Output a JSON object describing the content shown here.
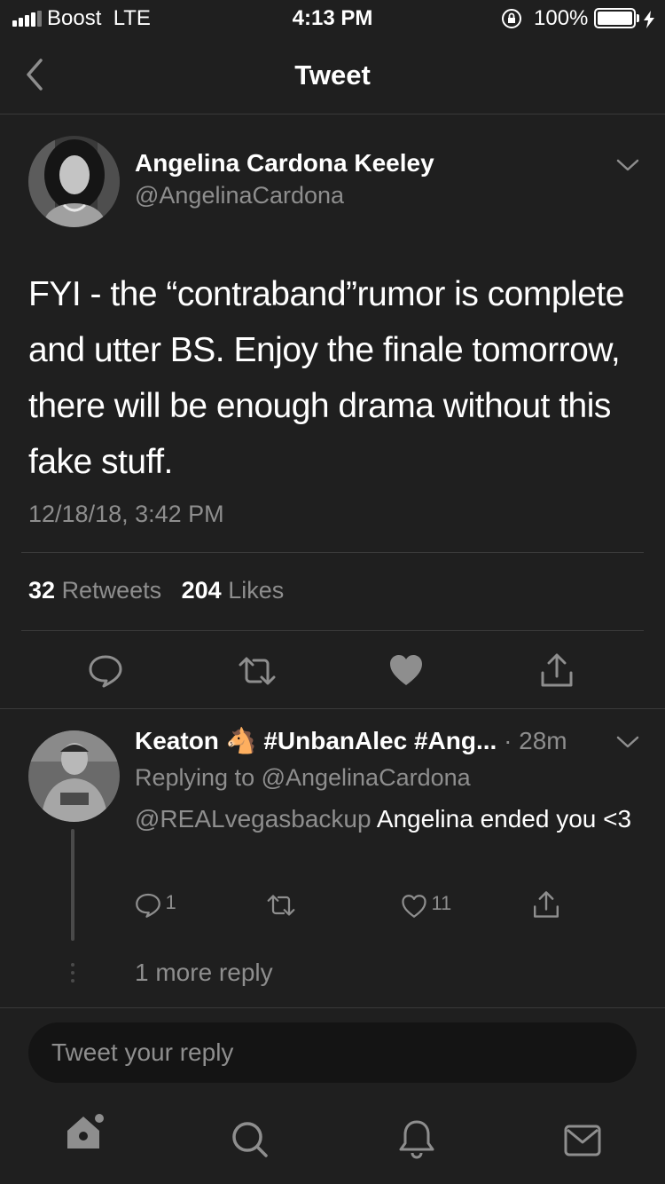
{
  "status_bar": {
    "carrier": "Boost  LTE",
    "time": "4:13 PM",
    "battery": "100%"
  },
  "nav": {
    "title": "Tweet",
    "back_icon": "chevron-left-icon"
  },
  "tweet": {
    "author_name": "Angelina Cardona Keeley",
    "author_handle": "@AngelinaCardona",
    "text": "FYI - the “contraband”rumor is complete and utter BS. Enjoy the finale tomorrow, there will be enough drama without this fake stuff.",
    "timestamp": "12/18/18, 3:42 PM",
    "retweet_count": "32",
    "retweet_label": "Retweets",
    "like_count": "204",
    "like_label": "Likes",
    "actions": [
      "reply-icon",
      "retweet-icon",
      "like-icon",
      "share-icon"
    ]
  },
  "reply": {
    "name": "Keaton",
    "name_emoji": "🐴",
    "name_suffix": "#UnbanAlec #Ang...",
    "time": "· 28m",
    "replying_to": "Replying to @AngelinaCardona",
    "mention": "@REALvegasbackup",
    "text": " Angelina ended you <3",
    "reply_count": "1",
    "retweet_count": "",
    "like_count": "11"
  },
  "more_replies": "1 more reply",
  "composer": {
    "placeholder": "Tweet your reply"
  },
  "tab_bar": [
    "home-icon",
    "search-icon",
    "notifications-icon",
    "messages-icon"
  ]
}
